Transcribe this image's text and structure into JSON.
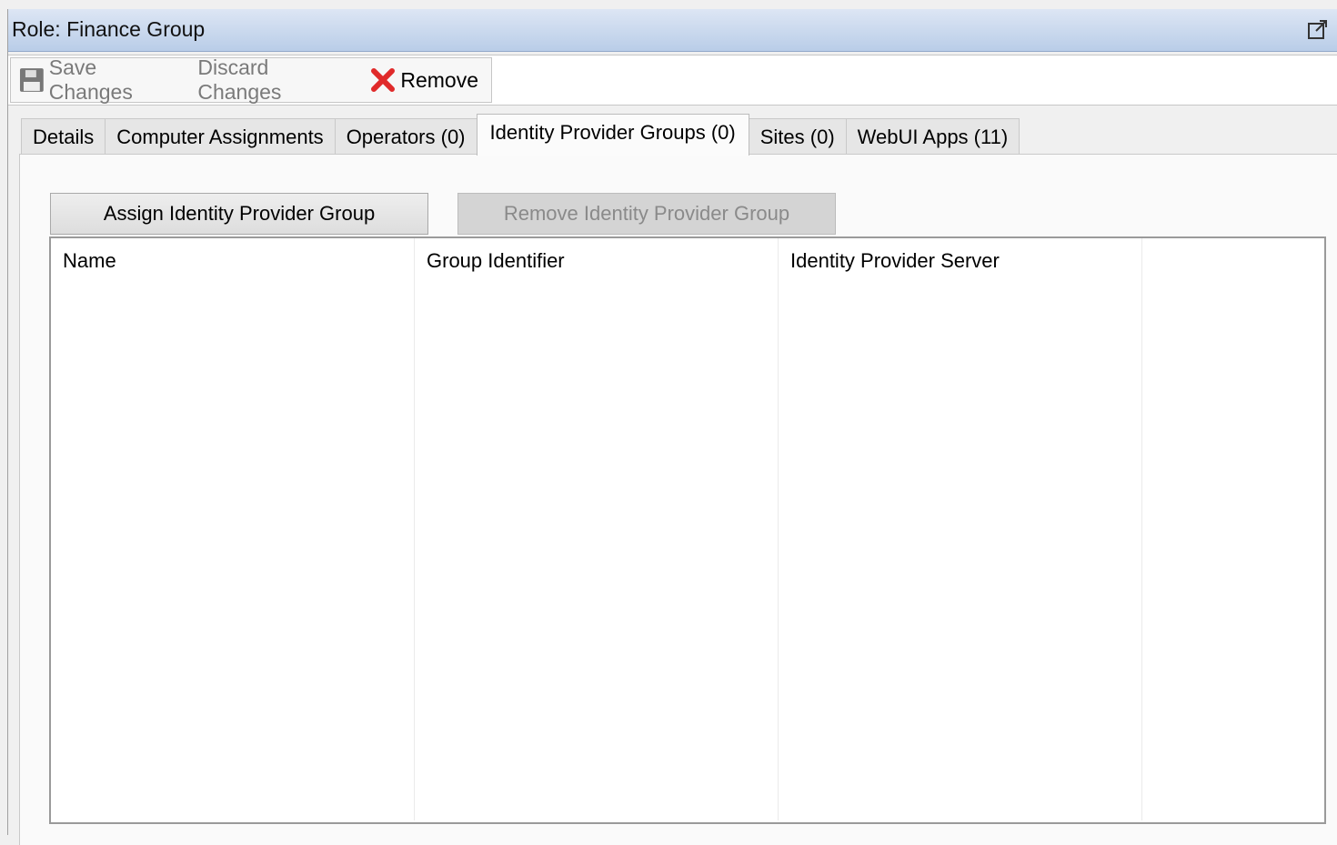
{
  "window": {
    "title": "Role: Finance Group"
  },
  "toolbar": {
    "save_label": "Save Changes",
    "discard_label": "Discard Changes",
    "remove_label": "Remove"
  },
  "tabs": [
    {
      "label": "Details"
    },
    {
      "label": "Computer Assignments"
    },
    {
      "label": "Operators (0)"
    },
    {
      "label": "Identity Provider Groups (0)",
      "active": true
    },
    {
      "label": "Sites (0)"
    },
    {
      "label": "WebUI Apps (11)"
    }
  ],
  "actions": {
    "assign_label": "Assign Identity Provider Group",
    "remove_label": "Remove Identity Provider Group"
  },
  "table": {
    "columns": [
      "Name",
      "Group Identifier",
      "Identity Provider Server",
      ""
    ],
    "rows": []
  },
  "colors": {
    "title_gradient_top": "#dde6f4",
    "title_gradient_bottom": "#b9cde8",
    "remove_icon": "#e02a2a"
  }
}
